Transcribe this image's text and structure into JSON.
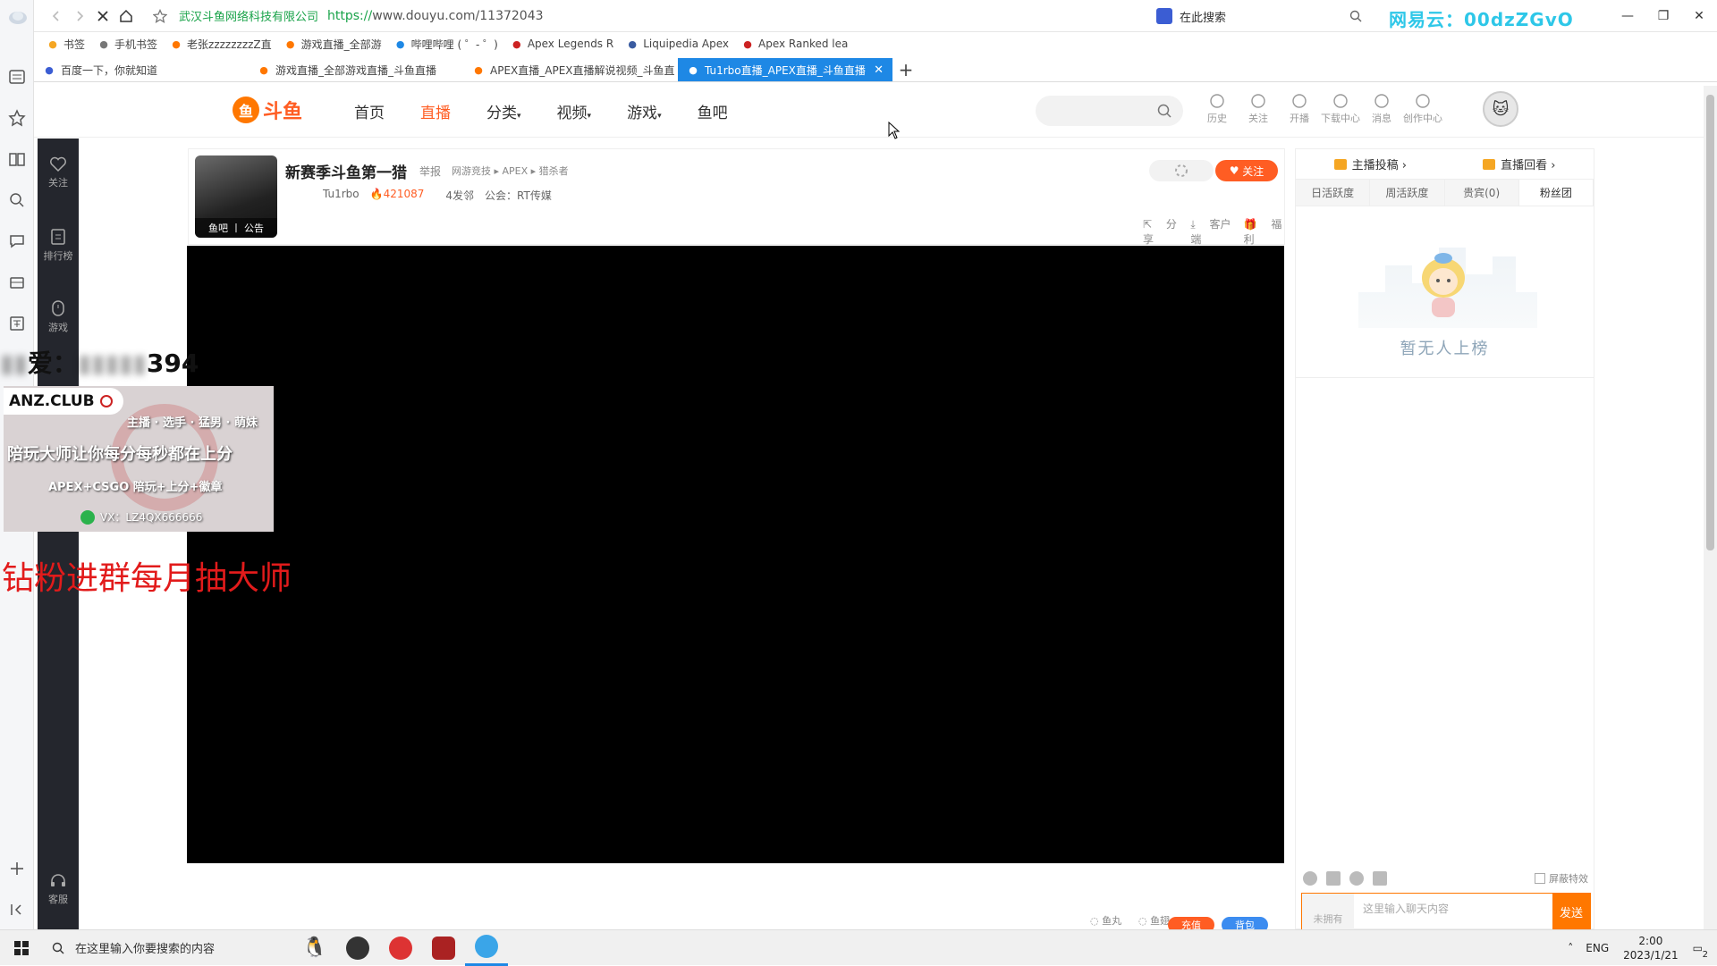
{
  "browser": {
    "url_company": "武汉斗鱼网络科技有限公司",
    "url_scheme": "https://",
    "url_rest": "www.douyu.com/11372043",
    "search_placeholder": "在此搜索",
    "watermark": "网易云：00dzZGvO",
    "bookmarks": [
      {
        "label": "书签",
        "icon": "star-icon",
        "color": "#f5a623"
      },
      {
        "label": "手机书签",
        "icon": "phone-icon",
        "color": "#777"
      },
      {
        "label": "老张zzzzzzzzZ直",
        "icon": "douyu-icon",
        "color": "#ff7700"
      },
      {
        "label": "游戏直播_全部游",
        "icon": "douyu-icon",
        "color": "#ff7700"
      },
      {
        "label": "哔哩哔哩 ( ゜- ゜)",
        "icon": "bilibili-icon",
        "color": "#1e88e5"
      },
      {
        "label": "Apex Legends R",
        "icon": "apex-icon",
        "color": "#c22"
      },
      {
        "label": "Liquipedia Apex",
        "icon": "liquipedia-icon",
        "color": "#3a5ba0"
      },
      {
        "label": "Apex Ranked lea",
        "icon": "apex-icon",
        "color": "#c22"
      }
    ],
    "tabs": [
      {
        "label": "百度一下，你就知道",
        "icon": "baidu-icon",
        "color": "#3b5dd3",
        "active": false
      },
      {
        "label": "游戏直播_全部游戏直播_斗鱼直播",
        "icon": "douyu-icon",
        "color": "#ff7700",
        "active": false
      },
      {
        "label": "APEX直播_APEX直播解说视频_斗鱼直",
        "icon": "douyu-icon",
        "color": "#ff7700",
        "active": false
      },
      {
        "label": "Tu1rbo直播_APEX直播_斗鱼直播",
        "icon": "douyu-icon",
        "color": "#ffffff",
        "active": true
      }
    ]
  },
  "site": {
    "logo_text": "斗鱼",
    "nav": [
      "首页",
      "直播",
      "分类",
      "视频",
      "游戏",
      "鱼吧"
    ],
    "nav_active": "直播",
    "header_icons": [
      "历史",
      "关注",
      "开播",
      "下载中心",
      "消息",
      "创作中心"
    ]
  },
  "left_nav": {
    "items": [
      "关注",
      "排行榜",
      "游戏"
    ],
    "support": "客服"
  },
  "room": {
    "title": "新赛季斗鱼第一猎",
    "report": "举报",
    "category": "网游竞技 ▸ APEX ▸ 猎杀者",
    "anchor": "Tu1rbo",
    "hot": "421087",
    "rank": "4发邻",
    "guild": "公会：RT传媒",
    "avatar_bar": "鱼吧 丨 公告",
    "follow": "关注",
    "actions": [
      "分享",
      "客户端",
      "福利"
    ]
  },
  "overlay": {
    "top_text_visible": "爱：",
    "top_text_digits": "394",
    "ad": {
      "brand": "ANZ.CLUB",
      "line1": "主播 · 选手 · 猛男 · 萌妹",
      "line2": "陪玩大师让你每分每秒都在上分",
      "line3": "APEX+CSGO  陪玩+上分+徽章",
      "line4": "VX：LZ4QX666666"
    },
    "red_text": "钻粉进群每月抽大师"
  },
  "right_panel": {
    "top_links": [
      "主播投稿 ›",
      "直播回看 ›"
    ],
    "tabs": [
      "日活跃度",
      "周活跃度",
      "贵宾(0)",
      "粉丝团"
    ],
    "active_tab": "粉丝团",
    "empty_text": "暂无人上榜",
    "mask_label": "屏蔽特效",
    "badge": "未拥有",
    "chat_placeholder": "这里输入聊天内容",
    "send": "发送"
  },
  "bottom": {
    "fish_ball": "鱼丸",
    "fish_fin": "鱼翅",
    "recharge": "充值",
    "backpack": "背包"
  },
  "taskbar": {
    "search_placeholder": "在这里输入你要搜索的内容",
    "lang": "ENG",
    "time": "2:00",
    "date": "2023/1/21",
    "notify_count": "2"
  }
}
